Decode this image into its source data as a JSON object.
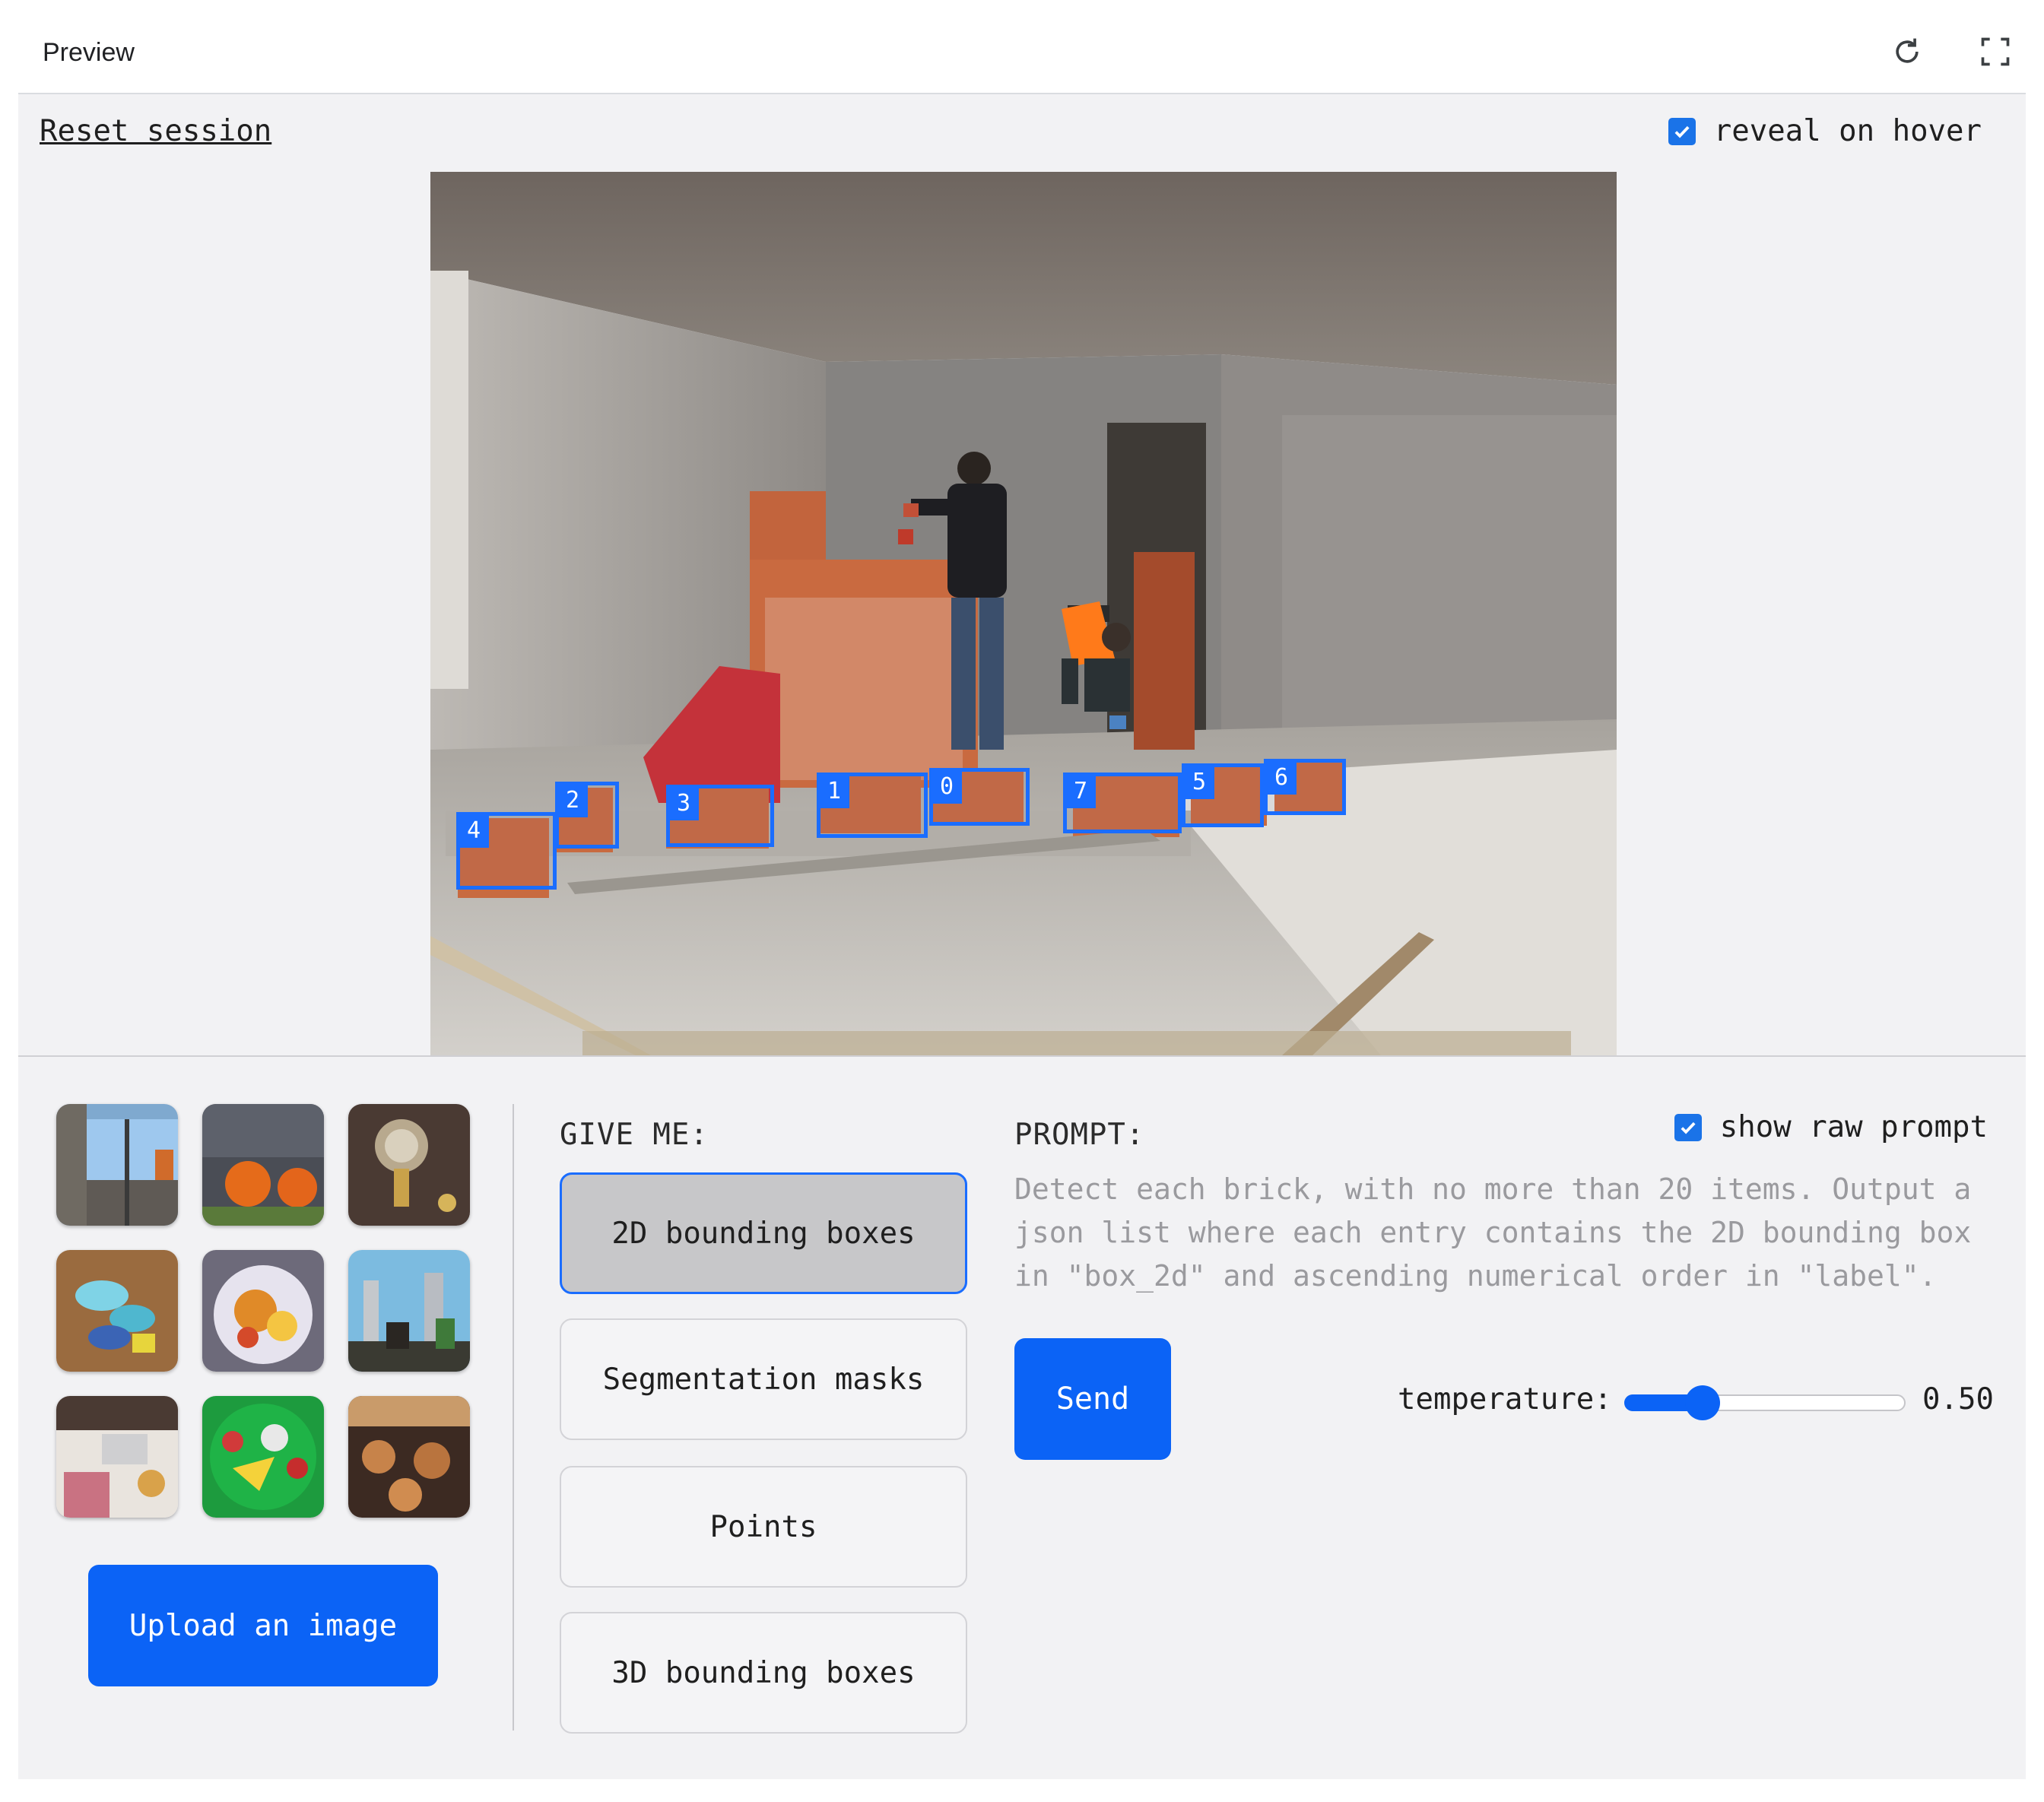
{
  "header": {
    "title": "Preview",
    "icons": [
      "refresh-icon",
      "fullscreen-icon"
    ]
  },
  "topbar": {
    "reset_label": "Reset session",
    "reveal_label": "reveal on hover",
    "reveal_checked": true
  },
  "detections": [
    {
      "label": "4"
    },
    {
      "label": "2"
    },
    {
      "label": "3"
    },
    {
      "label": "1"
    },
    {
      "label": "0"
    },
    {
      "label": "7"
    },
    {
      "label": "5"
    },
    {
      "label": "6"
    }
  ],
  "gallery": {
    "upload_label": "Upload an image"
  },
  "giveme": {
    "label": "GIVE ME:",
    "options": [
      "2D bounding boxes",
      "Segmentation masks",
      "Points",
      "3D bounding boxes"
    ],
    "selected": "2D bounding boxes"
  },
  "prompt": {
    "label": "PROMPT:",
    "raw_label": "show raw prompt",
    "raw_checked": true,
    "text": "Detect each brick, with no more than 20 items. Output a json list where each entry contains the 2D bounding box in \"box_2d\" and ascending numerical order in \"label\".",
    "send_label": "Send",
    "temperature_label": "temperature:",
    "temperature_value": "0.50",
    "temperature": 0.5
  },
  "colors": {
    "accent": "#0b63f6",
    "box": "#1a6dff",
    "panel": "#f2f2f4"
  }
}
